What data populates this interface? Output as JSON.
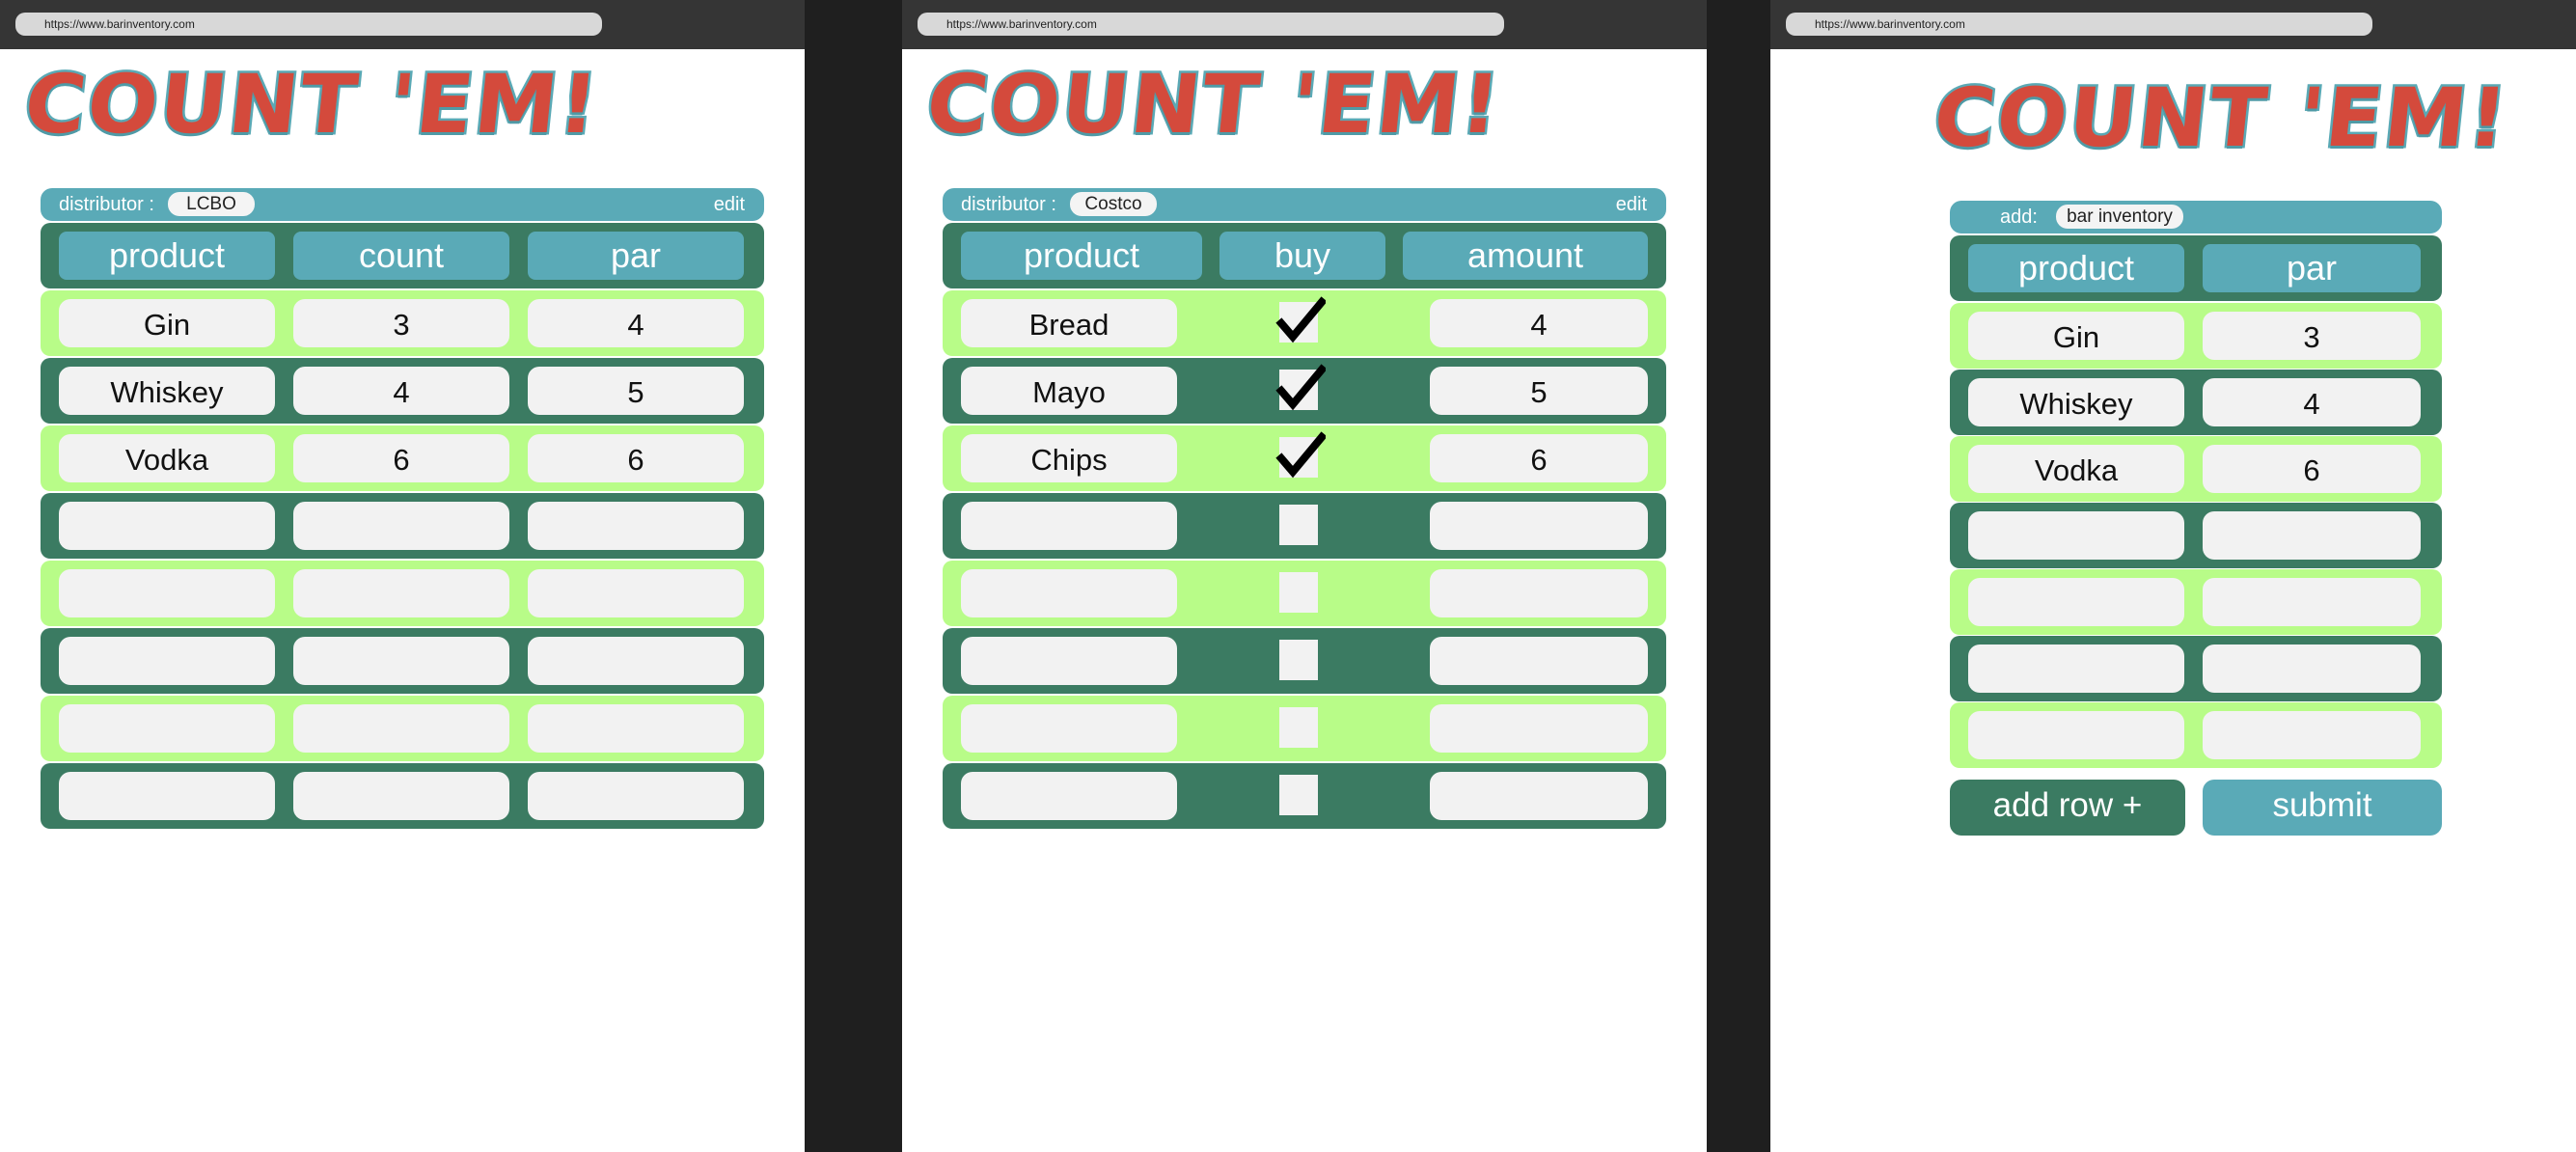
{
  "browser": {
    "url": "https://www.barinventory.com"
  },
  "app": {
    "logo": "COUNT 'EM!"
  },
  "count_screen": {
    "distributor_label": "distributor :",
    "distributor_value": "LCBO",
    "edit_label": "edit",
    "headers": [
      "product",
      "count",
      "par"
    ],
    "rows": [
      {
        "product": "Gin",
        "count": "3",
        "par": "4"
      },
      {
        "product": "Whiskey",
        "count": "4",
        "par": "5"
      },
      {
        "product": "Vodka",
        "count": "6",
        "par": "6"
      },
      {
        "product": "",
        "count": "",
        "par": ""
      },
      {
        "product": "",
        "count": "",
        "par": ""
      },
      {
        "product": "",
        "count": "",
        "par": ""
      },
      {
        "product": "",
        "count": "",
        "par": ""
      },
      {
        "product": "",
        "count": "",
        "par": ""
      }
    ]
  },
  "buy_screen": {
    "distributor_label": "distributor :",
    "distributor_value": "Costco",
    "edit_label": "edit",
    "headers": [
      "product",
      "buy",
      "amount"
    ],
    "rows": [
      {
        "product": "Bread",
        "buy": true,
        "amount": "4"
      },
      {
        "product": "Mayo",
        "buy": true,
        "amount": "5"
      },
      {
        "product": "Chips",
        "buy": true,
        "amount": "6"
      },
      {
        "product": "",
        "buy": false,
        "amount": ""
      },
      {
        "product": "",
        "buy": false,
        "amount": ""
      },
      {
        "product": "",
        "buy": false,
        "amount": ""
      },
      {
        "product": "",
        "buy": false,
        "amount": ""
      },
      {
        "product": "",
        "buy": false,
        "amount": ""
      }
    ]
  },
  "add_screen": {
    "add_label": "add:",
    "add_value": "bar inventory",
    "headers": [
      "product",
      "par"
    ],
    "rows": [
      {
        "product": "Gin",
        "par": "3"
      },
      {
        "product": "Whiskey",
        "par": "4"
      },
      {
        "product": "Vodka",
        "par": "6"
      },
      {
        "product": "",
        "par": ""
      },
      {
        "product": "",
        "par": ""
      },
      {
        "product": "",
        "par": ""
      },
      {
        "product": "",
        "par": ""
      }
    ],
    "add_row_label": "add row +",
    "submit_label": "submit"
  },
  "colors": {
    "background": "#1f1f1f",
    "browser_bar": "#353535",
    "teal": "#5aaab7",
    "dark_green": "#3b7b62",
    "light_green": "#b8fc88",
    "logo_red": "#d44a3c",
    "cell": "#f2f2f2"
  }
}
